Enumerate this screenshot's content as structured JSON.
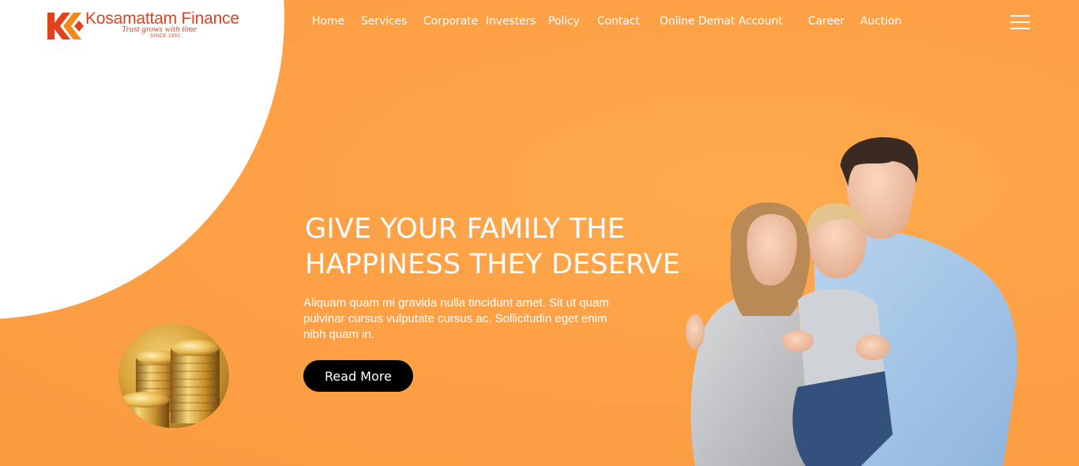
{
  "brand": {
    "name": "Kosamattam Finance",
    "tagline": "Trust grows with time",
    "since": "SINCE 1850",
    "accent_color": "#e0421e",
    "mark_color": "#f28a1b"
  },
  "nav": {
    "items": [
      {
        "label": "Home"
      },
      {
        "label": "Services"
      },
      {
        "label": "Corporate"
      },
      {
        "label": "Investers"
      },
      {
        "label": "Policy"
      },
      {
        "label": "Contact"
      },
      {
        "label": "Online Demat Account"
      },
      {
        "label": "Career"
      },
      {
        "label": "Auction"
      }
    ],
    "menu_icon": "hamburger-menu-icon"
  },
  "hero": {
    "headline_line1": "GIVE YOUR FAMILY THE",
    "headline_line2": "HAPPINESS THEY DESERVE",
    "description": "Aliquam quam mi gravida nulla tincidunt amet. Sit ut quam pulvinar cursus vulputate cursus ac. Sollicitudin eget enim nibh quam in.",
    "cta_label": "Read More",
    "background_color": "#fda046",
    "button_color": "#000000"
  }
}
